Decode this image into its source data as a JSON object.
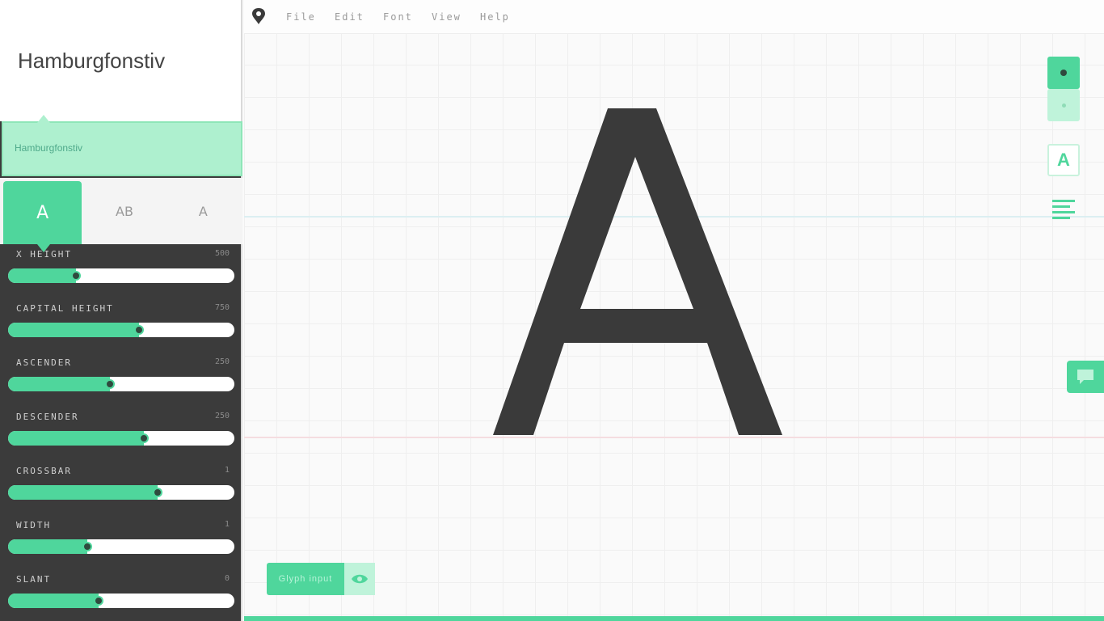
{
  "app": {
    "font_title": "Hamburgfonstiv",
    "font_name_field": "Hamburgfonstiv"
  },
  "menu": {
    "items": [
      "File",
      "Edit",
      "Font",
      "View",
      "Help"
    ]
  },
  "mode_tabs": [
    {
      "name": "glyph-mode",
      "icon": "A",
      "active": true
    },
    {
      "name": "words-mode",
      "icon": "AB",
      "active": false
    },
    {
      "name": "style-mode",
      "icon": "A",
      "active": false
    }
  ],
  "sliders": [
    {
      "label": "X HEIGHT",
      "value": "500",
      "fraction": 0.3
    },
    {
      "label": "CAPITAL HEIGHT",
      "value": "750",
      "fraction": 0.58
    },
    {
      "label": "ASCENDER",
      "value": "250",
      "fraction": 0.45
    },
    {
      "label": "DESCENDER",
      "value": "250",
      "fraction": 0.6
    },
    {
      "label": "CROSSBAR",
      "value": "1",
      "fraction": 0.66
    },
    {
      "label": "WIDTH",
      "value": "1",
      "fraction": 0.35
    },
    {
      "label": "SLANT",
      "value": "0",
      "fraction": 0.4
    }
  ],
  "canvas": {
    "glyph": "A",
    "glyph_input_label": "Glyph input"
  },
  "colors": {
    "accent": "#4fd69c",
    "accent_light": "#bff3da",
    "sidebar_bg": "#3b3b3b",
    "glyph": "#3a3a3a"
  },
  "icons": {
    "logo": "prototypo-logo-icon",
    "zoom_in": "zoom-in-icon",
    "zoom_out": "zoom-out-icon",
    "glyph_view": "glyph-view-icon",
    "list_view": "list-view-icon",
    "feedback": "chat-bubble-icon",
    "eye": "eye-icon"
  }
}
